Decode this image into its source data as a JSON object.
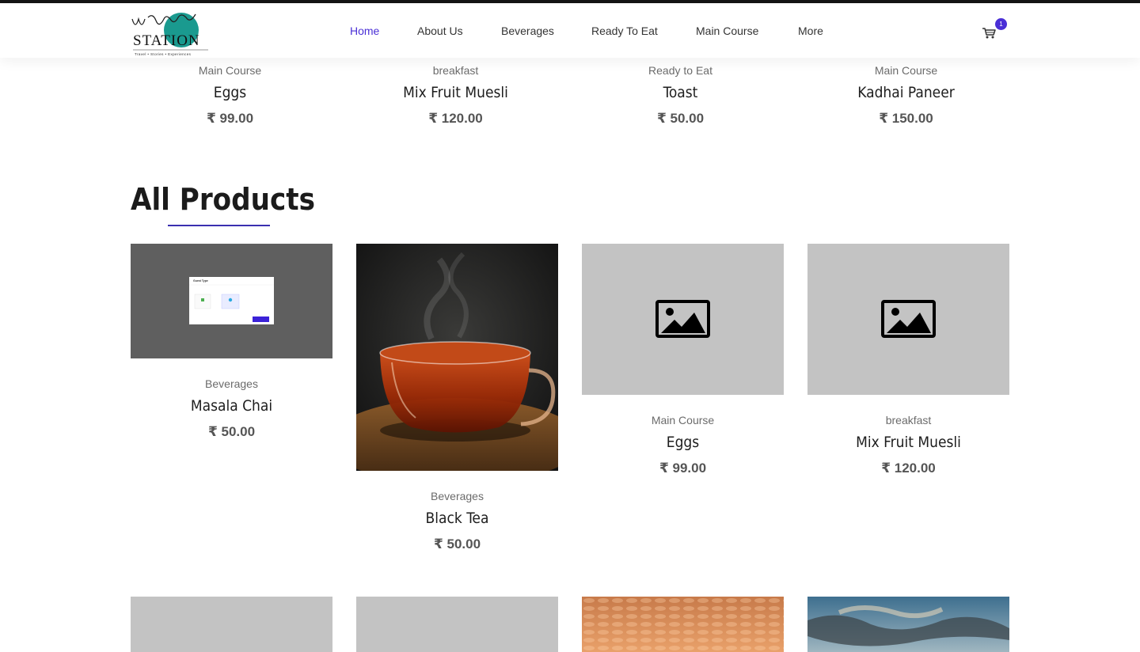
{
  "brand": {
    "name": "Wander Station",
    "tagline": "Travel • Stories • Experiences"
  },
  "nav": {
    "items": [
      "Home",
      "About Us",
      "Beverages",
      "Ready To Eat",
      "Main Course",
      "More"
    ],
    "active": "Home"
  },
  "cart": {
    "count": "1",
    "icon": "cart-icon"
  },
  "top_products": [
    {
      "category": "Main Course",
      "name": "Eggs",
      "price": "₹ 99.00"
    },
    {
      "category": "breakfast",
      "name": "Mix Fruit Muesli",
      "price": "₹ 120.00"
    },
    {
      "category": "Ready to Eat",
      "name": "Toast",
      "price": "₹ 50.00"
    },
    {
      "category": "Main Course",
      "name": "Kadhai Paneer",
      "price": "₹ 150.00"
    }
  ],
  "all_products": {
    "heading": "All Products",
    "items": [
      {
        "category": "Beverages",
        "name": "Masala Chai",
        "price": "₹ 50.00"
      },
      {
        "category": "Beverages",
        "name": "Black Tea",
        "price": "₹ 50.00"
      },
      {
        "category": "Main Course",
        "name": "Eggs",
        "price": "₹ 99.00"
      },
      {
        "category": "breakfast",
        "name": "Mix Fruit Muesli",
        "price": "₹ 120.00"
      }
    ],
    "mini_dialog": {
      "title": "Guest Type"
    }
  },
  "colors": {
    "accent": "#4a2fd6",
    "underline": "#3a2fb0",
    "placeholder": "#c3c3c3",
    "logo_circle": "#1a9a8f"
  }
}
